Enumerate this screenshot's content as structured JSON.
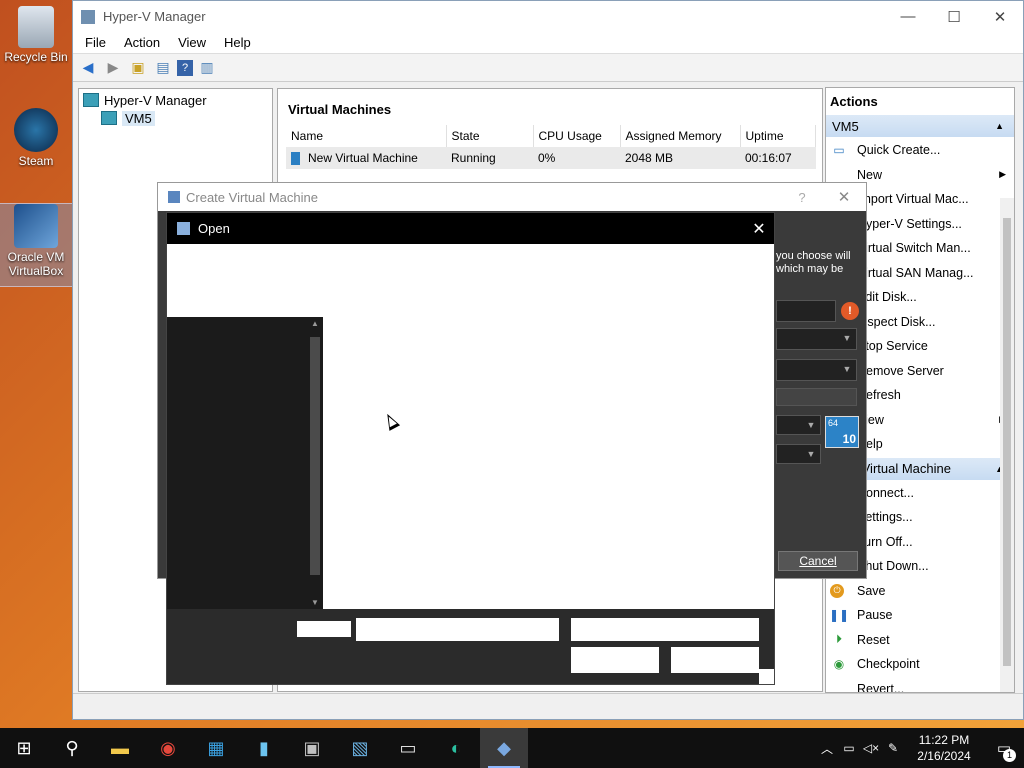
{
  "desktop": {
    "icons": [
      {
        "label": "Recycle Bin"
      },
      {
        "label": "Steam"
      },
      {
        "label": "Oracle VM VirtualBox"
      }
    ]
  },
  "hyperv": {
    "title": "Hyper-V Manager",
    "menu": [
      "File",
      "Action",
      "View",
      "Help"
    ],
    "tree": {
      "root": "Hyper-V Manager",
      "child": "VM5"
    },
    "center": {
      "section_title": "Virtual Machines",
      "columns": [
        "Name",
        "State",
        "CPU Usage",
        "Assigned Memory",
        "Uptime"
      ],
      "rows": [
        [
          "New Virtual Machine",
          "Running",
          "0%",
          "2048 MB",
          "00:16:07"
        ]
      ]
    },
    "actions": {
      "heading": "Actions",
      "group_host": "VM5",
      "host_items": [
        "Quick Create...",
        "New",
        "Import Virtual Mac...",
        "Hyper-V Settings...",
        "Virtual Switch Man...",
        "Virtual SAN Manag...",
        "Edit Disk...",
        "Inspect Disk...",
        "Stop Service",
        "Remove Server",
        "Refresh",
        "View",
        "Help"
      ],
      "group_vm": "New Virtual Machine",
      "vm_items": [
        "Connect...",
        "Settings...",
        "Turn Off...",
        "Shut Down...",
        "Save",
        "Pause",
        "Reset",
        "Checkpoint",
        "Revert..."
      ]
    }
  },
  "create_vm_dialog": {
    "title": "Create Virtual Machine",
    "help_glyph": "?",
    "info_text_1": "you choose will",
    "info_text_2": "which may be",
    "cancel_label": "Cancel",
    "warn_glyph": "!",
    "os_badge_top": "64",
    "os_badge_num": "10"
  },
  "open_dialog": {
    "title": "Open",
    "close_glyph": "✕"
  },
  "taskbar": {
    "time": "11:22 PM",
    "date": "2/16/2024",
    "notification_count": "1"
  }
}
